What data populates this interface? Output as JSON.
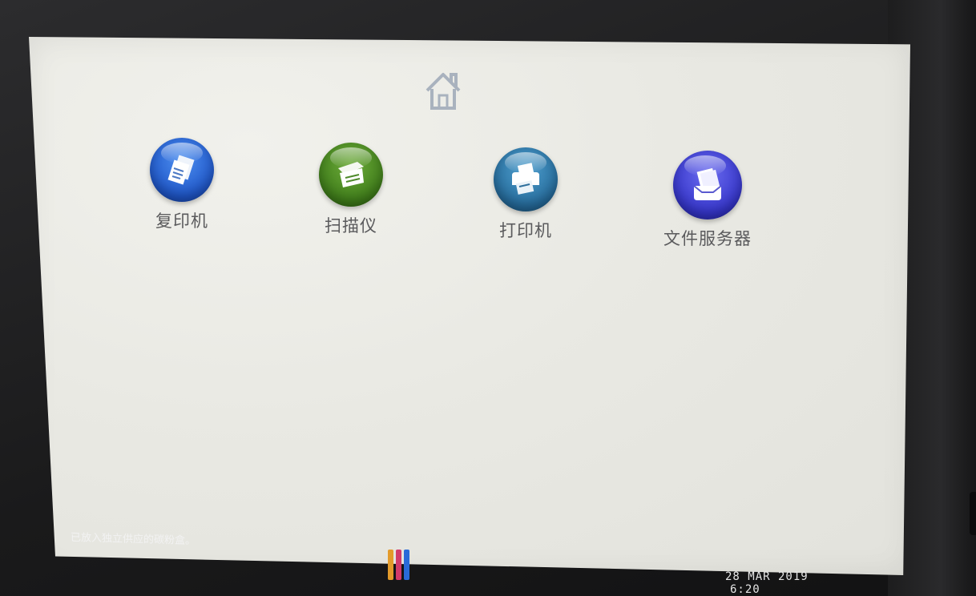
{
  "home": {
    "icon": "home-icon"
  },
  "apps": [
    {
      "label": "复印机",
      "icon": "copier-icon",
      "color": "#1f56c8"
    },
    {
      "label": "扫描仪",
      "icon": "scanner-icon",
      "color": "#3f7d1a"
    },
    {
      "label": "打印机",
      "icon": "printer-icon",
      "color": "#256a9a"
    },
    {
      "label": "文件服务器",
      "icon": "file-server-icon",
      "color": "#3434c8"
    }
  ],
  "status": {
    "message": "已放入独立供应的碳粉盒。"
  },
  "toner_levels": {
    "colors": [
      "#e39a2a",
      "#d23a6a",
      "#2a6ad8"
    ]
  },
  "clock": {
    "date": "28 MAR  2019",
    "time": "6:20"
  }
}
